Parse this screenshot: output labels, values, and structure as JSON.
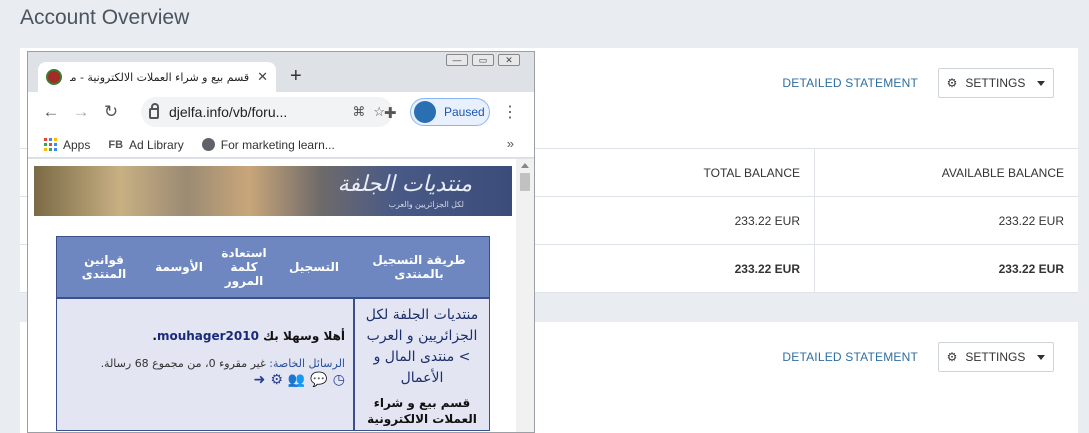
{
  "page": {
    "title": "Account Overview"
  },
  "card1": {
    "detailed_statement": "DETAILED STATEMENT",
    "settings": "SETTINGS",
    "table": {
      "headers": [
        "",
        "TOTAL BALANCE",
        "AVAILABLE BALANCE"
      ],
      "rows": [
        [
          "",
          "233.22 EUR",
          "233.22 EUR"
        ],
        [
          "",
          "233.22 EUR",
          "233.22 EUR"
        ]
      ]
    }
  },
  "card2": {
    "detailed_statement": "DETAILED STATEMENT",
    "settings": "SETTINGS"
  },
  "browser": {
    "tab_title": "قسم بيع و شراء العملات الالكترونية - منتدي",
    "url": "djelfa.info/vb/foru...",
    "profile_status": "Paused",
    "bookmarks": [
      "Apps",
      "Ad Library",
      "For marketing learn..."
    ],
    "fb_label": "FB",
    "more": "»"
  },
  "forum": {
    "banner_title": "منتديات الجلفة",
    "banner_sub": "لكل الجزائريين والعرب",
    "nav": [
      "طريقة التسجيل بالمنتدى",
      "التسجيل",
      "استعادة كلمة المرور",
      "الأوسمة",
      "قوانين المنتدى"
    ],
    "crumb": "منتديات الجلفة لكل الجزائريين و العرب > منتدى المال و الأعمال",
    "crumb_leaf": "قسم بيع و شراء العملات الالكترونية",
    "greeting": "أهلا وسهلا بك",
    "username": "mouhager2010",
    "pm_label": "الرسائل الخاصة:",
    "pm_text": "غير مقروء 0، من مجموع 68 رسالة."
  }
}
